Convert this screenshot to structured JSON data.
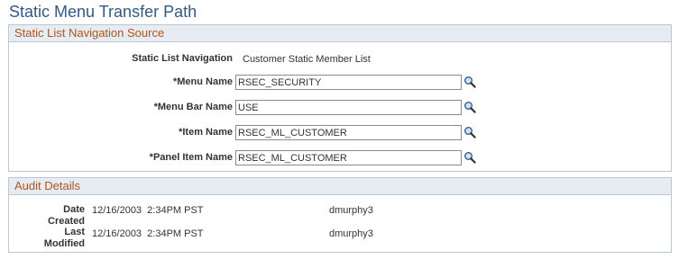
{
  "page": {
    "title": "Static Menu Transfer Path"
  },
  "source": {
    "header": "Static List Navigation Source",
    "static_nav_label": "Static List Navigation",
    "static_nav_value": "Customer Static Member List",
    "menu_name_label": "*Menu Name",
    "menu_name_value": "RSEC_SECURITY",
    "menu_bar_label": "*Menu Bar Name",
    "menu_bar_value": "USE",
    "item_name_label": "*Item Name",
    "item_name_value": "RSEC_ML_CUSTOMER",
    "panel_item_label": "*Panel Item Name",
    "panel_item_value": "RSEC_ML_CUSTOMER",
    "lookup_icon": "magnifier-lookup-icon"
  },
  "audit": {
    "header": "Audit Details",
    "created_label_1": "Date",
    "created_label_2": "Created",
    "created_value": "12/16/2003  2:34PM PST",
    "created_by": "dmurphy3",
    "modified_label_1": "Last",
    "modified_label_2": "Modified",
    "modified_value": "12/16/2003  2:34PM PST",
    "modified_by": "dmurphy3"
  }
}
